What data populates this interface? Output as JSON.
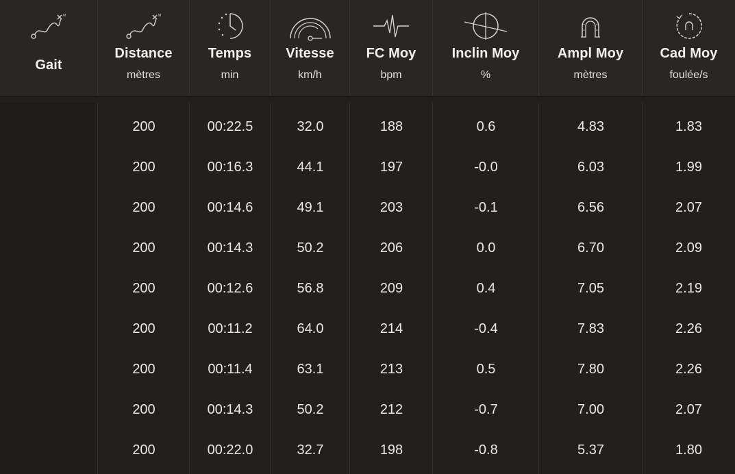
{
  "columns": [
    {
      "key": "gait",
      "title": "Gait",
      "unit": "",
      "icon": "gait-path-icon"
    },
    {
      "key": "distance",
      "title": "Distance",
      "unit": "mètres",
      "icon": "distance-path-icon"
    },
    {
      "key": "temps",
      "title": "Temps",
      "unit": "min",
      "icon": "stopwatch-icon"
    },
    {
      "key": "vitesse",
      "title": "Vitesse",
      "unit": "km/h",
      "icon": "speedometer-icon"
    },
    {
      "key": "fc",
      "title": "FC Moy",
      "unit": "bpm",
      "icon": "heartbeat-icon"
    },
    {
      "key": "inclin",
      "title": "Inclin Moy",
      "unit": "%",
      "icon": "incline-icon"
    },
    {
      "key": "ampl",
      "title": "Ampl Moy",
      "unit": "mètres",
      "icon": "horseshoe-icon"
    },
    {
      "key": "cad",
      "title": "Cad Moy",
      "unit": "foulée/s",
      "icon": "cadence-icon"
    }
  ],
  "rows": [
    {
      "gait": "",
      "distance": "200",
      "temps": "00:22.5",
      "vitesse": "32.0",
      "fc": "188",
      "inclin": "0.6",
      "ampl": "4.83",
      "cad": "1.83"
    },
    {
      "gait": "",
      "distance": "200",
      "temps": "00:16.3",
      "vitesse": "44.1",
      "fc": "197",
      "inclin": "-0.0",
      "ampl": "6.03",
      "cad": "1.99"
    },
    {
      "gait": "",
      "distance": "200",
      "temps": "00:14.6",
      "vitesse": "49.1",
      "fc": "203",
      "inclin": "-0.1",
      "ampl": "6.56",
      "cad": "2.07"
    },
    {
      "gait": "",
      "distance": "200",
      "temps": "00:14.3",
      "vitesse": "50.2",
      "fc": "206",
      "inclin": "0.0",
      "ampl": "6.70",
      "cad": "2.09"
    },
    {
      "gait": "",
      "distance": "200",
      "temps": "00:12.6",
      "vitesse": "56.8",
      "fc": "209",
      "inclin": "0.4",
      "ampl": "7.05",
      "cad": "2.19"
    },
    {
      "gait": "",
      "distance": "200",
      "temps": "00:11.2",
      "vitesse": "64.0",
      "fc": "214",
      "inclin": "-0.4",
      "ampl": "7.83",
      "cad": "2.26"
    },
    {
      "gait": "",
      "distance": "200",
      "temps": "00:11.4",
      "vitesse": "63.1",
      "fc": "213",
      "inclin": "0.5",
      "ampl": "7.80",
      "cad": "2.26"
    },
    {
      "gait": "",
      "distance": "200",
      "temps": "00:14.3",
      "vitesse": "50.2",
      "fc": "212",
      "inclin": "-0.7",
      "ampl": "7.00",
      "cad": "2.07"
    },
    {
      "gait": "",
      "distance": "200",
      "temps": "00:22.0",
      "vitesse": "32.7",
      "fc": "198",
      "inclin": "-0.8",
      "ampl": "5.37",
      "cad": "1.80"
    }
  ],
  "colors": {
    "background": "#231f1d",
    "header_background": "#2a2624",
    "text": "#ebe7e3"
  }
}
